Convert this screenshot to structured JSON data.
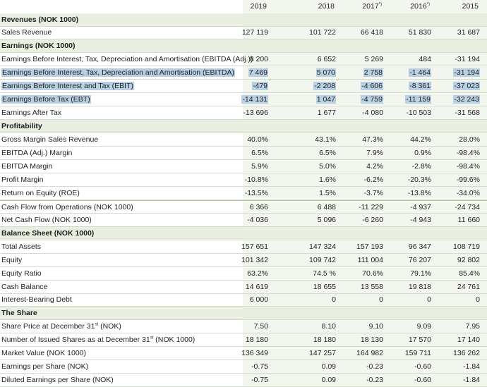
{
  "header": {
    "years": [
      {
        "label": "2019",
        "note": ""
      },
      {
        "label": "2018",
        "note": ""
      },
      {
        "label": "2017",
        "note": "*)"
      },
      {
        "label": "2016",
        "note": "*)"
      },
      {
        "label": "2015",
        "note": ""
      }
    ]
  },
  "rows": [
    {
      "type": "section",
      "label": "Revenues (NOK 1000)"
    },
    {
      "type": "data",
      "label": "Sales Revenue",
      "values": [
        "127 119",
        "101 722",
        "66 418",
        "51 830",
        "31 687"
      ]
    },
    {
      "type": "section",
      "label": "Earnings (NOK 1000)"
    },
    {
      "type": "data",
      "label": "Earnings Before Interest, Tax, Depreciation and Amortisation (EBITDA (Adj.))",
      "values": [
        "8 200",
        "6 652",
        "5 269",
        "484",
        "-31 194"
      ]
    },
    {
      "type": "data",
      "label": "Earnings Before Interest, Tax, Depreciation and Amortisation (EBITDA)",
      "values": [
        "7 469",
        "5 070",
        "2 758",
        "-1 464",
        "-31 194"
      ],
      "highlight": true
    },
    {
      "type": "data",
      "label": "Earnings Before Interest and Tax (EBIT)",
      "values": [
        "-479",
        "-2 208",
        "-4 606",
        "-8 361",
        "-37 023"
      ],
      "highlight": true
    },
    {
      "type": "data",
      "label": "Earnings Before Tax (EBT)",
      "values": [
        "-14 131",
        "1 047",
        "-4 759",
        "-11 159",
        "-32 243"
      ],
      "highlight": true
    },
    {
      "type": "data",
      "label": "Earnings After Tax",
      "values": [
        "-13 696",
        "1 677",
        "-4 080",
        "-10 503",
        "-31 568"
      ]
    },
    {
      "type": "section",
      "label": "Profitability"
    },
    {
      "type": "data",
      "label": "Gross Margin Sales Revenue",
      "values": [
        "40.0%",
        "43.1%",
        "47.3%",
        "44.2%",
        "28.0%"
      ]
    },
    {
      "type": "data",
      "label": "EBITDA (Adj.) Margin",
      "values": [
        "6.5%",
        "6.5%",
        "7.9%",
        "0.9%",
        "-98.4%"
      ]
    },
    {
      "type": "data",
      "label": "EBITDA Margin",
      "values": [
        "5.9%",
        "5.0%",
        "4.2%",
        "-2.8%",
        "-98.4%"
      ]
    },
    {
      "type": "data",
      "label": "Profit Margin",
      "values": [
        "-10.8%",
        "1.6%",
        "-6.2%",
        "-20.3%",
        "-99.6%"
      ]
    },
    {
      "type": "data",
      "label": "Return on Equity (ROE)",
      "values": [
        "-13.5%",
        "1.5%",
        "-3.7%",
        "-13.8%",
        "-34.0%"
      ]
    },
    {
      "type": "data",
      "label": "Cash Flow from Operations (NOK 1000)",
      "values": [
        "6 366",
        "6 488",
        "-11 229",
        "-4 937",
        "-24 734"
      ],
      "thick": true
    },
    {
      "type": "data",
      "label": "Net Cash Flow (NOK 1000)",
      "values": [
        "-4 036",
        "5 096",
        "-6 260",
        "-4 943",
        "11 660"
      ]
    },
    {
      "type": "section",
      "label": "Balance Sheet (NOK 1000)"
    },
    {
      "type": "data",
      "label": "Total Assets",
      "values": [
        "157 651",
        "147 324",
        "157 193",
        "96 347",
        "108 719"
      ]
    },
    {
      "type": "data",
      "label": "Equity",
      "values": [
        "101 342",
        "109 742",
        "111 004",
        "76 207",
        "92 802"
      ]
    },
    {
      "type": "data",
      "label": "Equity Ratio",
      "values": [
        "63.2%",
        "74.5 %",
        "70.6%",
        "79.1%",
        "85.4%"
      ]
    },
    {
      "type": "data",
      "label": "Cash Balance",
      "values": [
        "14 619",
        "18 655",
        "13 558",
        "19 818",
        "24 761"
      ]
    },
    {
      "type": "data",
      "label": "Interest-Bearing Debt",
      "values": [
        "6 000",
        "0",
        "0",
        "0",
        "0"
      ]
    },
    {
      "type": "section",
      "label": "The Share"
    },
    {
      "type": "data",
      "label": "Share Price at December 31",
      "sup": "st",
      "suffix": " (NOK)",
      "values": [
        "7.50",
        "8.10",
        "9.10",
        "9.09",
        "7.95"
      ]
    },
    {
      "type": "data",
      "label": "Number of Issued Shares as at December 31",
      "sup": "st",
      "suffix": " (NOK 1000)",
      "values": [
        "18 180",
        "18 180",
        "18 130",
        "17 570",
        "17 140"
      ]
    },
    {
      "type": "data",
      "label": "Market Value (NOK 1000)",
      "values": [
        "136 349",
        "147 257",
        "164 982",
        "159 711",
        "136 262"
      ]
    },
    {
      "type": "data",
      "label": "Earnings per Share (NOK)",
      "values": [
        "-0.75",
        "0.09",
        "-0.23",
        "-0.60",
        "-1.84"
      ]
    },
    {
      "type": "data",
      "label": "Diluted Earnings per Share (NOK)",
      "values": [
        "-0.75",
        "0.09",
        "-0.23",
        "-0.60",
        "-1.84"
      ]
    }
  ]
}
